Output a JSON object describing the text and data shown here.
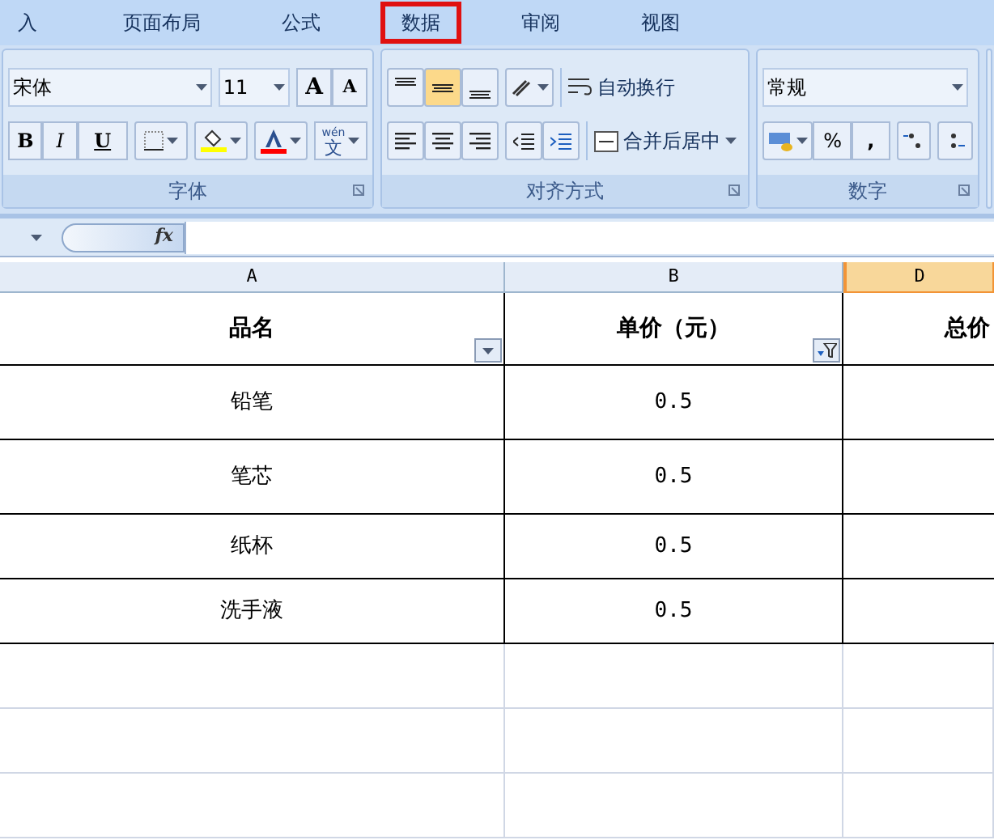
{
  "tabs": [
    {
      "label": "入",
      "highlighted": false
    },
    {
      "label": "页面布局",
      "highlighted": false
    },
    {
      "label": "公式",
      "highlighted": false
    },
    {
      "label": "数据",
      "highlighted": true
    },
    {
      "label": "审阅",
      "highlighted": false
    },
    {
      "label": "视图",
      "highlighted": false
    }
  ],
  "ribbon": {
    "font_group": {
      "title": "字体",
      "font_name": "宋体",
      "font_size": "11",
      "grow_label": "A",
      "shrink_label": "A",
      "bold_label": "B",
      "italic_label": "I",
      "underline_label": "U",
      "color_buttons": [
        {
          "kind": "fill",
          "color": "#ffff00"
        },
        {
          "kind": "font",
          "color": "#ff0000"
        }
      ],
      "phonetic_top": "wén",
      "phonetic_bottom": "文"
    },
    "align_group": {
      "title": "对齐方式",
      "vertical_align": [
        {
          "kind": "top",
          "selected": false
        },
        {
          "kind": "middle",
          "selected": true
        },
        {
          "kind": "bottom",
          "selected": false
        }
      ],
      "wrap_label": "自动换行",
      "merge_label": "合并后居中"
    },
    "number_group": {
      "title": "数字",
      "format": "常规",
      "percent_label": "%",
      "comma_label": ","
    }
  },
  "formula_bar": {
    "fx": "fx"
  },
  "columns": [
    {
      "label": "A",
      "selected": false
    },
    {
      "label": "B",
      "selected": false
    },
    {
      "label": "D",
      "selected": true
    }
  ],
  "table": {
    "header": [
      {
        "text": "品名",
        "kind": "dropdown"
      },
      {
        "text": "单价（元）",
        "kind": "filtered"
      },
      {
        "text": "总价",
        "kind": "plain"
      }
    ],
    "rows": [
      [
        "铅笔",
        "0.5"
      ],
      [
        "笔芯",
        "0.5"
      ],
      [
        "纸杯",
        "0.5"
      ],
      [
        "洗手液",
        "0.5"
      ]
    ]
  }
}
